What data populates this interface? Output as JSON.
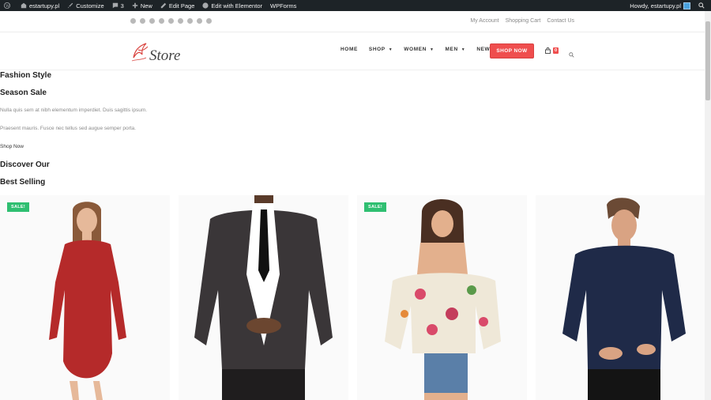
{
  "adminbar": {
    "site": "estartupy.pl",
    "customize": "Customize",
    "comments": "3",
    "new": "New",
    "edit_page": "Edit Page",
    "edit_elementor": "Edit with Elementor",
    "wpforms": "WPForms",
    "howdy": "Howdy, estartupy.pl"
  },
  "topbar": {
    "social_icons": [
      "twitter-icon",
      "facebook-icon",
      "globe-icon",
      "pinterest-icon",
      "dribbble-icon",
      "instagram-icon",
      "youtube-icon",
      "vimeo-icon",
      "rss-icon"
    ],
    "links": [
      "My Account",
      "Shopping Cart",
      "Contact Us"
    ]
  },
  "header": {
    "logo_text": "Store",
    "nav": [
      "HOME",
      "SHOP",
      "WOMEN",
      "MEN",
      "NEWS"
    ],
    "shop_now": "SHOP NOW",
    "cart_count": "0"
  },
  "content": {
    "h1": "Fashion Style",
    "h2": "Season Sale",
    "p1": "Nulla quis sem at nibh elementum imperdiet. Duis sagittis ipsum.",
    "p2": "Praesent mauris. Fusce nec tellus sed augue semper porta.",
    "shop_link": "Shop Now",
    "h3": "Discover Our",
    "h4": "Best Selling"
  },
  "products": [
    {
      "sale": "SALE!"
    },
    {
      "sale": ""
    },
    {
      "sale": "SALE!"
    },
    {
      "sale": ""
    }
  ],
  "colors": {
    "accent": "#ef4e4e",
    "sale": "#2fbf71",
    "adminbar": "#1d2327"
  }
}
